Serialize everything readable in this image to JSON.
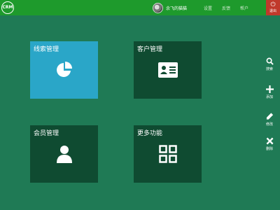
{
  "app": {
    "logo_text": "CRM"
  },
  "header": {
    "username": "余飞的猫猫",
    "nav": [
      "设置",
      "反馈",
      "帮户"
    ],
    "power_label": "退出"
  },
  "tiles": [
    {
      "title": "线索管理",
      "icon": "pie-chart-icon",
      "color": "#2aa6c8"
    },
    {
      "title": "客户管理",
      "icon": "contact-card-icon",
      "color": "#0f4b31"
    },
    {
      "title": "会员管理",
      "icon": "user-icon",
      "color": "#0f4b31"
    },
    {
      "title": "更多功能",
      "icon": "grid-icon",
      "color": "#0f4b31"
    }
  ],
  "actions": [
    {
      "label": "搜索",
      "icon": "search-icon"
    },
    {
      "label": "添加",
      "icon": "plus-icon"
    },
    {
      "label": "修改",
      "icon": "pencil-icon"
    },
    {
      "label": "删除",
      "icon": "close-icon"
    }
  ],
  "colors": {
    "background": "#1f7a55",
    "topbar": "#1e9a2c",
    "tile_dark": "#0f4b31",
    "tile_light": "#2aa6c8",
    "power": "#c0392b"
  }
}
